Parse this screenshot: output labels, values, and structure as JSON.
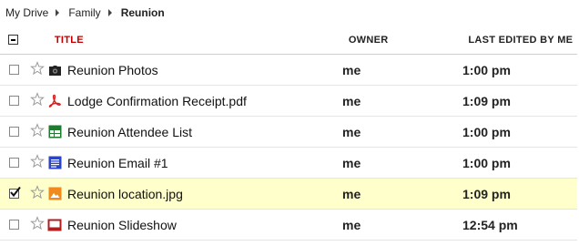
{
  "breadcrumb": [
    "My Drive",
    "Family",
    "Reunion"
  ],
  "columns": {
    "title": "TITLE",
    "owner": "OWNER",
    "last_edited": "LAST EDITED BY ME"
  },
  "files": [
    {
      "name": "Reunion Photos",
      "icon": "folder-icon",
      "owner": "me",
      "edited": "1:00 pm",
      "checked": false
    },
    {
      "name": "Lodge Confirmation Receipt.pdf",
      "icon": "pdf-icon",
      "owner": "me",
      "edited": "1:09 pm",
      "checked": false
    },
    {
      "name": "Reunion Attendee List",
      "icon": "spreadsheet-icon",
      "owner": "me",
      "edited": "1:00 pm",
      "checked": false
    },
    {
      "name": "Reunion Email #1",
      "icon": "document-icon",
      "owner": "me",
      "edited": "1:00 pm",
      "checked": false
    },
    {
      "name": "Reunion location.jpg",
      "icon": "image-icon",
      "owner": "me",
      "edited": "1:09 pm",
      "checked": true
    },
    {
      "name": "Reunion Slideshow",
      "icon": "presentation-icon",
      "owner": "me",
      "edited": "12:54 pm",
      "checked": false
    }
  ],
  "colors": {
    "title_header": "#c00000",
    "selected_row": "#ffffcc",
    "pdf": "#d42020",
    "spreadsheet": "#1e7a2e",
    "document": "#2a44c4",
    "image": "#f08a1c",
    "presentation": "#b01e1e"
  }
}
